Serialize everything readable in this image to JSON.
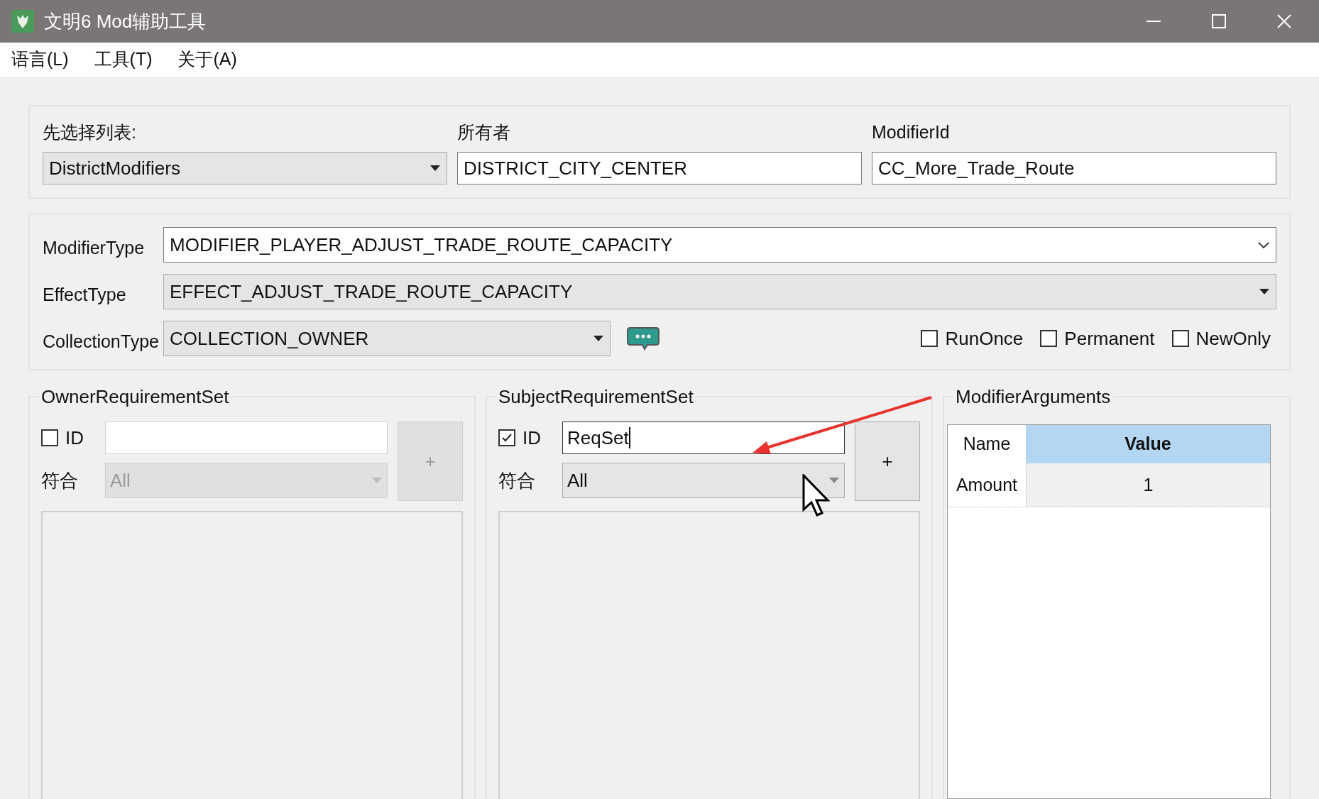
{
  "window": {
    "title": "文明6 Mod辅助工具"
  },
  "menu": [
    {
      "label": "语言(L)"
    },
    {
      "label": "工具(T)"
    },
    {
      "label": "关于(A)"
    }
  ],
  "top_fields": [
    {
      "label": "先选择列表:",
      "value": "DistrictModifiers",
      "kind": "combo"
    },
    {
      "label": "所有者",
      "value": "DISTRICT_CITY_CENTER",
      "kind": "text"
    },
    {
      "label": "ModifierId",
      "value": "CC_More_Trade_Route",
      "kind": "text"
    }
  ],
  "type_rows": [
    {
      "label": "ModifierType",
      "value": "MODIFIER_PLAYER_ADJUST_TRADE_ROUTE_CAPACITY",
      "kind": "editable"
    },
    {
      "label": "EffectType",
      "value": "EFFECT_ADJUST_TRADE_ROUTE_CAPACITY",
      "kind": "readonly"
    },
    {
      "label": "CollectionType",
      "value": "COLLECTION_OWNER",
      "kind": "readonly"
    }
  ],
  "flags": [
    {
      "label": "RunOnce",
      "checked": false
    },
    {
      "label": "Permanent",
      "checked": false
    },
    {
      "label": "NewOnly",
      "checked": false
    }
  ],
  "requirement_sets": [
    {
      "title": "OwnerRequirementSet",
      "id_label": "ID",
      "checked": false,
      "match_label": "符合",
      "match_value": "All",
      "add_button": "+"
    },
    {
      "title": "SubjectRequirementSet",
      "id_label": "ID",
      "checked": true,
      "id_value": "ReqSet",
      "match_label": "符合",
      "match_value": "All",
      "add_button": "+"
    }
  ],
  "arguments": {
    "title": "ModifierArguments",
    "columns": [
      {
        "label": "Name",
        "selected": false
      },
      {
        "label": "Value",
        "selected": true
      }
    ],
    "rows": [
      {
        "name": "Amount",
        "value": "1"
      }
    ]
  }
}
